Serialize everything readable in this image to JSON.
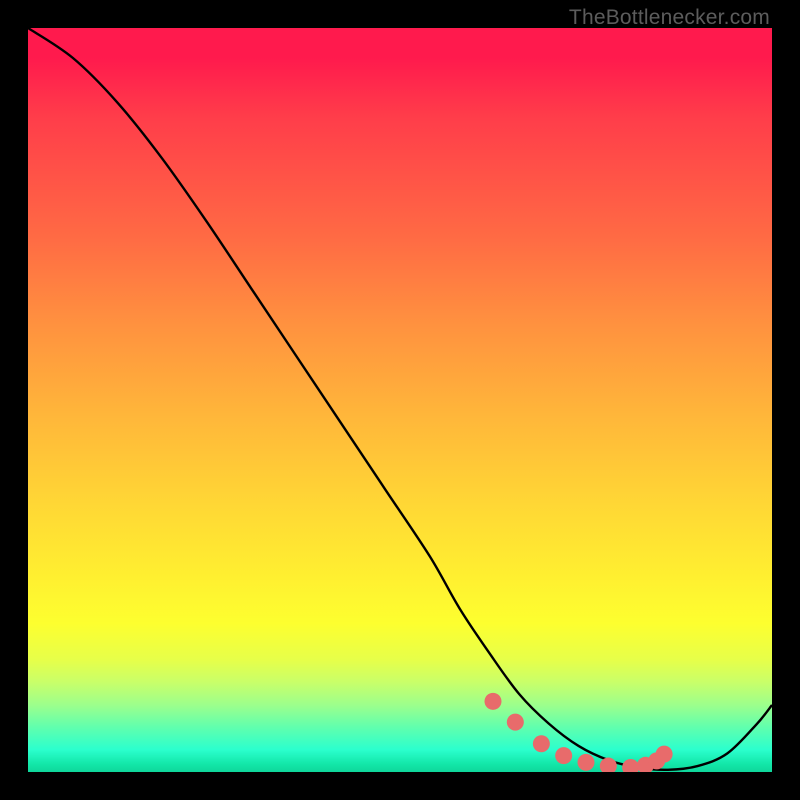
{
  "watermark": "TheBottlenecker.com",
  "chart_data": {
    "type": "line",
    "title": "",
    "xlabel": "",
    "ylabel": "",
    "xlim": [
      0,
      100
    ],
    "ylim": [
      0,
      100
    ],
    "series": [
      {
        "name": "bottleneck-curve",
        "x": [
          0,
          6,
          12,
          18,
          24,
          30,
          36,
          42,
          48,
          54,
          58,
          62,
          66,
          70,
          74,
          78,
          82,
          86,
          90,
          94,
          98,
          100
        ],
        "y": [
          100,
          96,
          90,
          82.5,
          74,
          65,
          56,
          47,
          38,
          29,
          22,
          16,
          10.5,
          6.5,
          3.5,
          1.6,
          0.6,
          0.3,
          0.8,
          2.5,
          6.5,
          9
        ]
      }
    ],
    "markers": {
      "name": "highlight-dots",
      "x": [
        62.5,
        65.5,
        69,
        72,
        75,
        78,
        81,
        83,
        84.5,
        85.5
      ],
      "y": [
        9.5,
        6.7,
        3.8,
        2.2,
        1.3,
        0.8,
        0.6,
        0.9,
        1.5,
        2.4
      ]
    },
    "gradient_stops": [
      {
        "pos": 0,
        "color": "#ff1a4d"
      },
      {
        "pos": 50,
        "color": "#ffc038"
      },
      {
        "pos": 80,
        "color": "#fdff2f"
      },
      {
        "pos": 100,
        "color": "#12e6a7"
      }
    ]
  }
}
